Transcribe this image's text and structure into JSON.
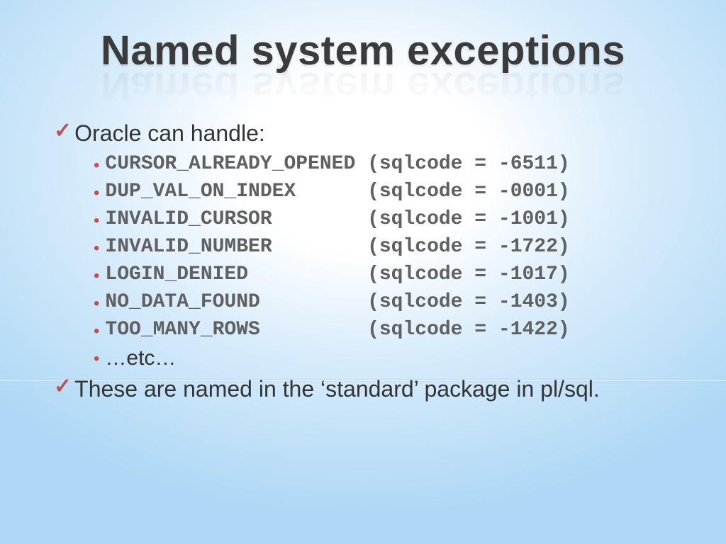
{
  "title": "Named system exceptions",
  "lead": "Oracle can handle:",
  "exceptions": [
    {
      "line": "CURSOR_ALREADY_OPENED (sqlcode = -6511)"
    },
    {
      "line": "DUP_VAL_ON_INDEX      (sqlcode = -0001)"
    },
    {
      "line": "INVALID_CURSOR        (sqlcode = -1001)"
    },
    {
      "line": "INVALID_NUMBER        (sqlcode = -1722)"
    },
    {
      "line": "LOGIN_DENIED          (sqlcode = -1017)"
    },
    {
      "line": "NO_DATA_FOUND         (sqlcode = -1403)"
    },
    {
      "line": "TOO_MANY_ROWS         (sqlcode = -1422)"
    }
  ],
  "etc": "…etc…",
  "footer": "These are named in the ‘standard’ package in pl/sql."
}
